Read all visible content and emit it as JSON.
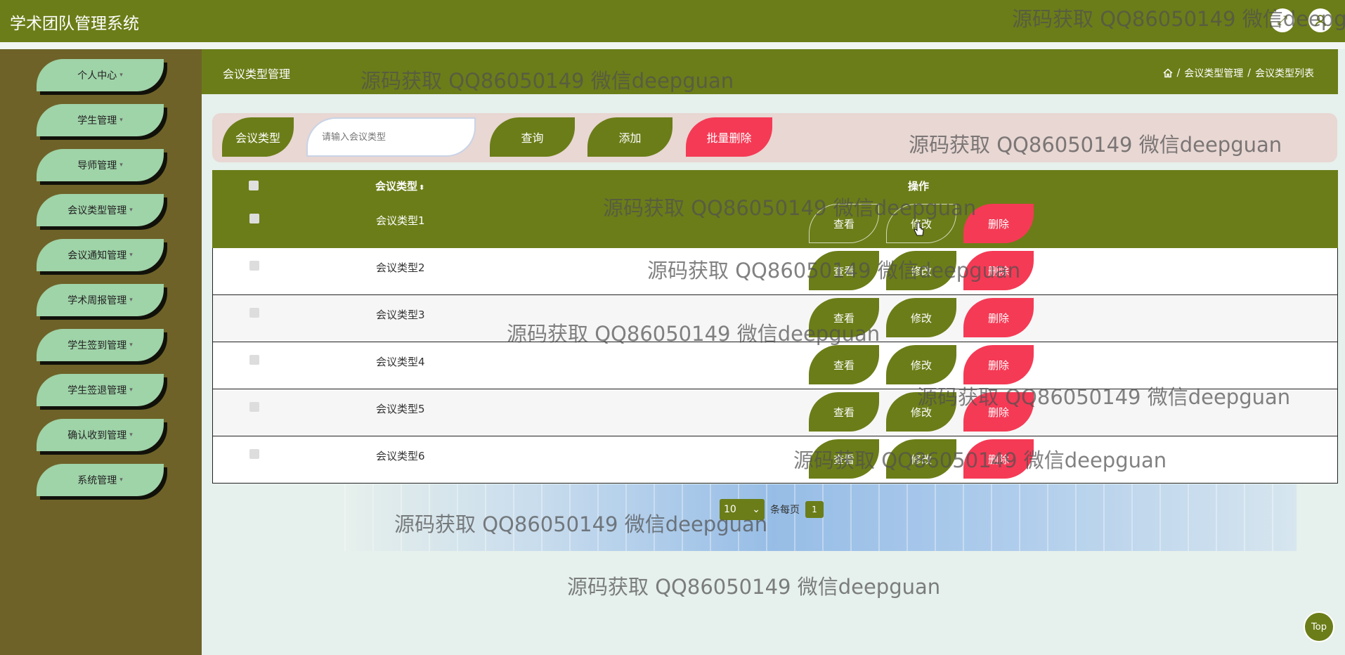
{
  "app": {
    "title": "学术团队管理系统"
  },
  "sidebar": {
    "items": [
      {
        "label": "个人中心",
        "name": "personal-center"
      },
      {
        "label": "学生管理",
        "name": "student-management"
      },
      {
        "label": "导师管理",
        "name": "advisor-management"
      },
      {
        "label": "会议类型管理",
        "name": "meeting-type-management"
      },
      {
        "label": "会议通知管理",
        "name": "meeting-notice-management"
      },
      {
        "label": "学术周报管理",
        "name": "weekly-report-management"
      },
      {
        "label": "学生签到管理",
        "name": "student-checkin-management"
      },
      {
        "label": "学生签退管理",
        "name": "student-checkout-management"
      },
      {
        "label": "确认收到管理",
        "name": "receipt-confirm-management"
      },
      {
        "label": "系统管理",
        "name": "system-management"
      }
    ]
  },
  "header": {
    "page_title": "会议类型管理",
    "breadcrumb": [
      "会议类型管理",
      "会议类型列表"
    ],
    "sep": "/"
  },
  "search": {
    "label": "会议类型",
    "placeholder": "请输入会议类型",
    "query": "查询",
    "add": "添加",
    "batch_delete": "批量删除"
  },
  "table": {
    "col_name": "会议类型",
    "col_ops": "操作",
    "sort_glyph": "⬍",
    "rows": [
      "会议类型1",
      "会议类型2",
      "会议类型3",
      "会议类型4",
      "会议类型5",
      "会议类型6"
    ],
    "actions": {
      "view": "查看",
      "edit": "修改",
      "delete": "删除"
    }
  },
  "pagination": {
    "page_size": "10",
    "per_page": "条每页",
    "current": "1"
  },
  "top_button": "Top",
  "watermark": "源码获取 QQ86050149 微信deepguan",
  "watermark_cut": "源码获取 QQ86050149 微信deepg",
  "colors": {
    "primary": "#6b7d18",
    "danger": "#f53a55",
    "sidebar": "#6e6228",
    "sidebar_item": "#9fd3a8"
  }
}
